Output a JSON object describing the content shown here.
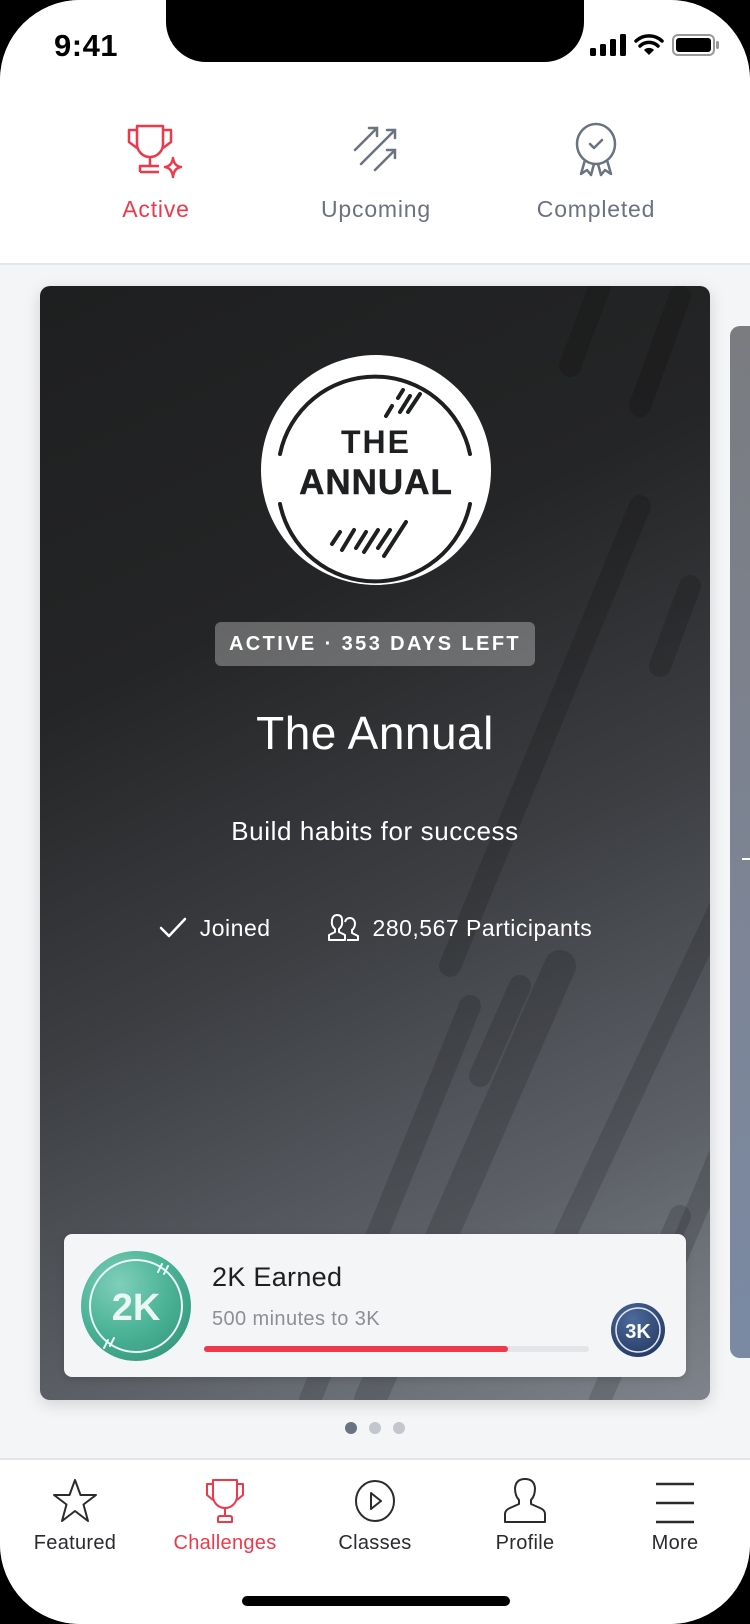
{
  "status_bar": {
    "time": "9:41"
  },
  "top_tabs": [
    {
      "label": "Active",
      "icon": "trophy-sparkle-icon",
      "active": true
    },
    {
      "label": "Upcoming",
      "icon": "arrows-up-right-icon",
      "active": false
    },
    {
      "label": "Completed",
      "icon": "award-ribbon-icon",
      "active": false
    }
  ],
  "challenge": {
    "logo_line1": "THE",
    "logo_line2": "ANNUAL",
    "status_pill": "ACTIVE · 353 DAYS LEFT",
    "title": "The Annual",
    "subtitle": "Build habits for success",
    "joined_label": "Joined",
    "participants_label": "280,567 Participants",
    "progress": {
      "current_badge": "2K",
      "earned_label": "2K Earned",
      "remaining_label": "500 minutes to 3K",
      "next_badge": "3K",
      "percent": 79
    }
  },
  "carousel": {
    "page_count": 3,
    "current_page": 1
  },
  "bottom_nav": [
    {
      "label": "Featured",
      "icon": "star-icon",
      "active": false
    },
    {
      "label": "Challenges",
      "icon": "trophy-icon",
      "active": true
    },
    {
      "label": "Classes",
      "icon": "play-circle-icon",
      "active": false
    },
    {
      "label": "Profile",
      "icon": "person-icon",
      "active": false
    },
    {
      "label": "More",
      "icon": "menu-icon",
      "active": false
    }
  ],
  "colors": {
    "accent": "#f0384b",
    "inactive": "#6b7280",
    "badge_2k": "#4bb396",
    "badge_3k": "#2f4a7a"
  }
}
